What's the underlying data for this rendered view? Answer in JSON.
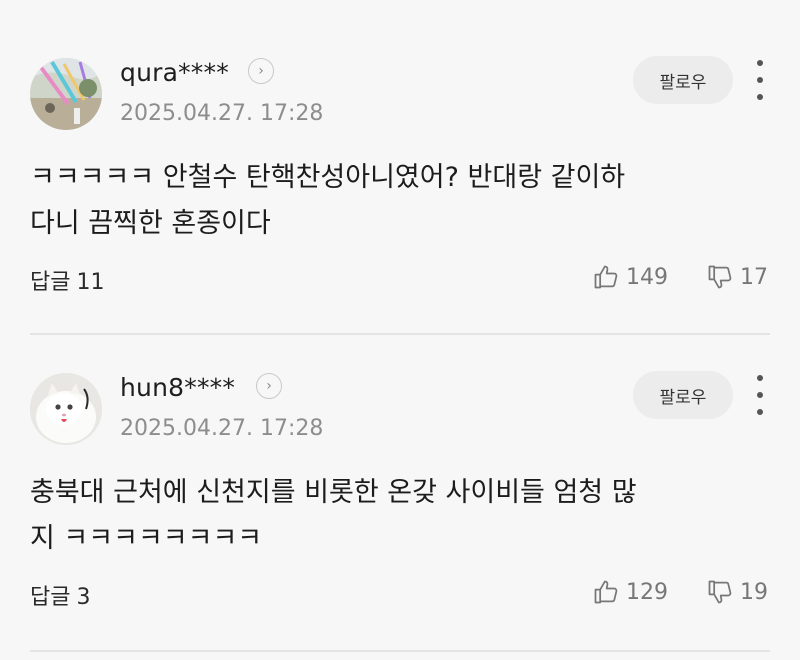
{
  "comments": [
    {
      "username": "qura****",
      "timestamp": "2025.04.27. 17:28",
      "follow_label": "팔로우",
      "body_lines": [
        "ㅋㅋㅋㅋㅋ 안철수 탄핵찬성아니였어? 반대랑 같이하",
        "다니 끔찍한 혼종이다"
      ],
      "reply_label": "답글",
      "reply_count": "11",
      "likes": "149",
      "dislikes": "17",
      "avatar_icon": "avatar-photo-outdoor"
    },
    {
      "username": "hun8****",
      "timestamp": "2025.04.27. 17:28",
      "follow_label": "팔로우",
      "body_lines": [
        "충북대 근처에 신천지를 비롯한 온갖 사이비들 엄청 많",
        "지 ㅋㅋㅋㅋㅋㅋㅋㅋ"
      ],
      "reply_label": "답글",
      "reply_count": "3",
      "likes": "129",
      "dislikes": "19",
      "avatar_icon": "avatar-photo-white-cat"
    }
  ],
  "icons": {
    "profile": "chevron-right-icon",
    "more": "more-vertical-icon",
    "like": "thumbs-up-icon",
    "dislike": "thumbs-down-icon"
  },
  "colors": {
    "background": "#f7f7f7",
    "button_bg": "#ececec",
    "muted_text": "#8d8d8d"
  }
}
